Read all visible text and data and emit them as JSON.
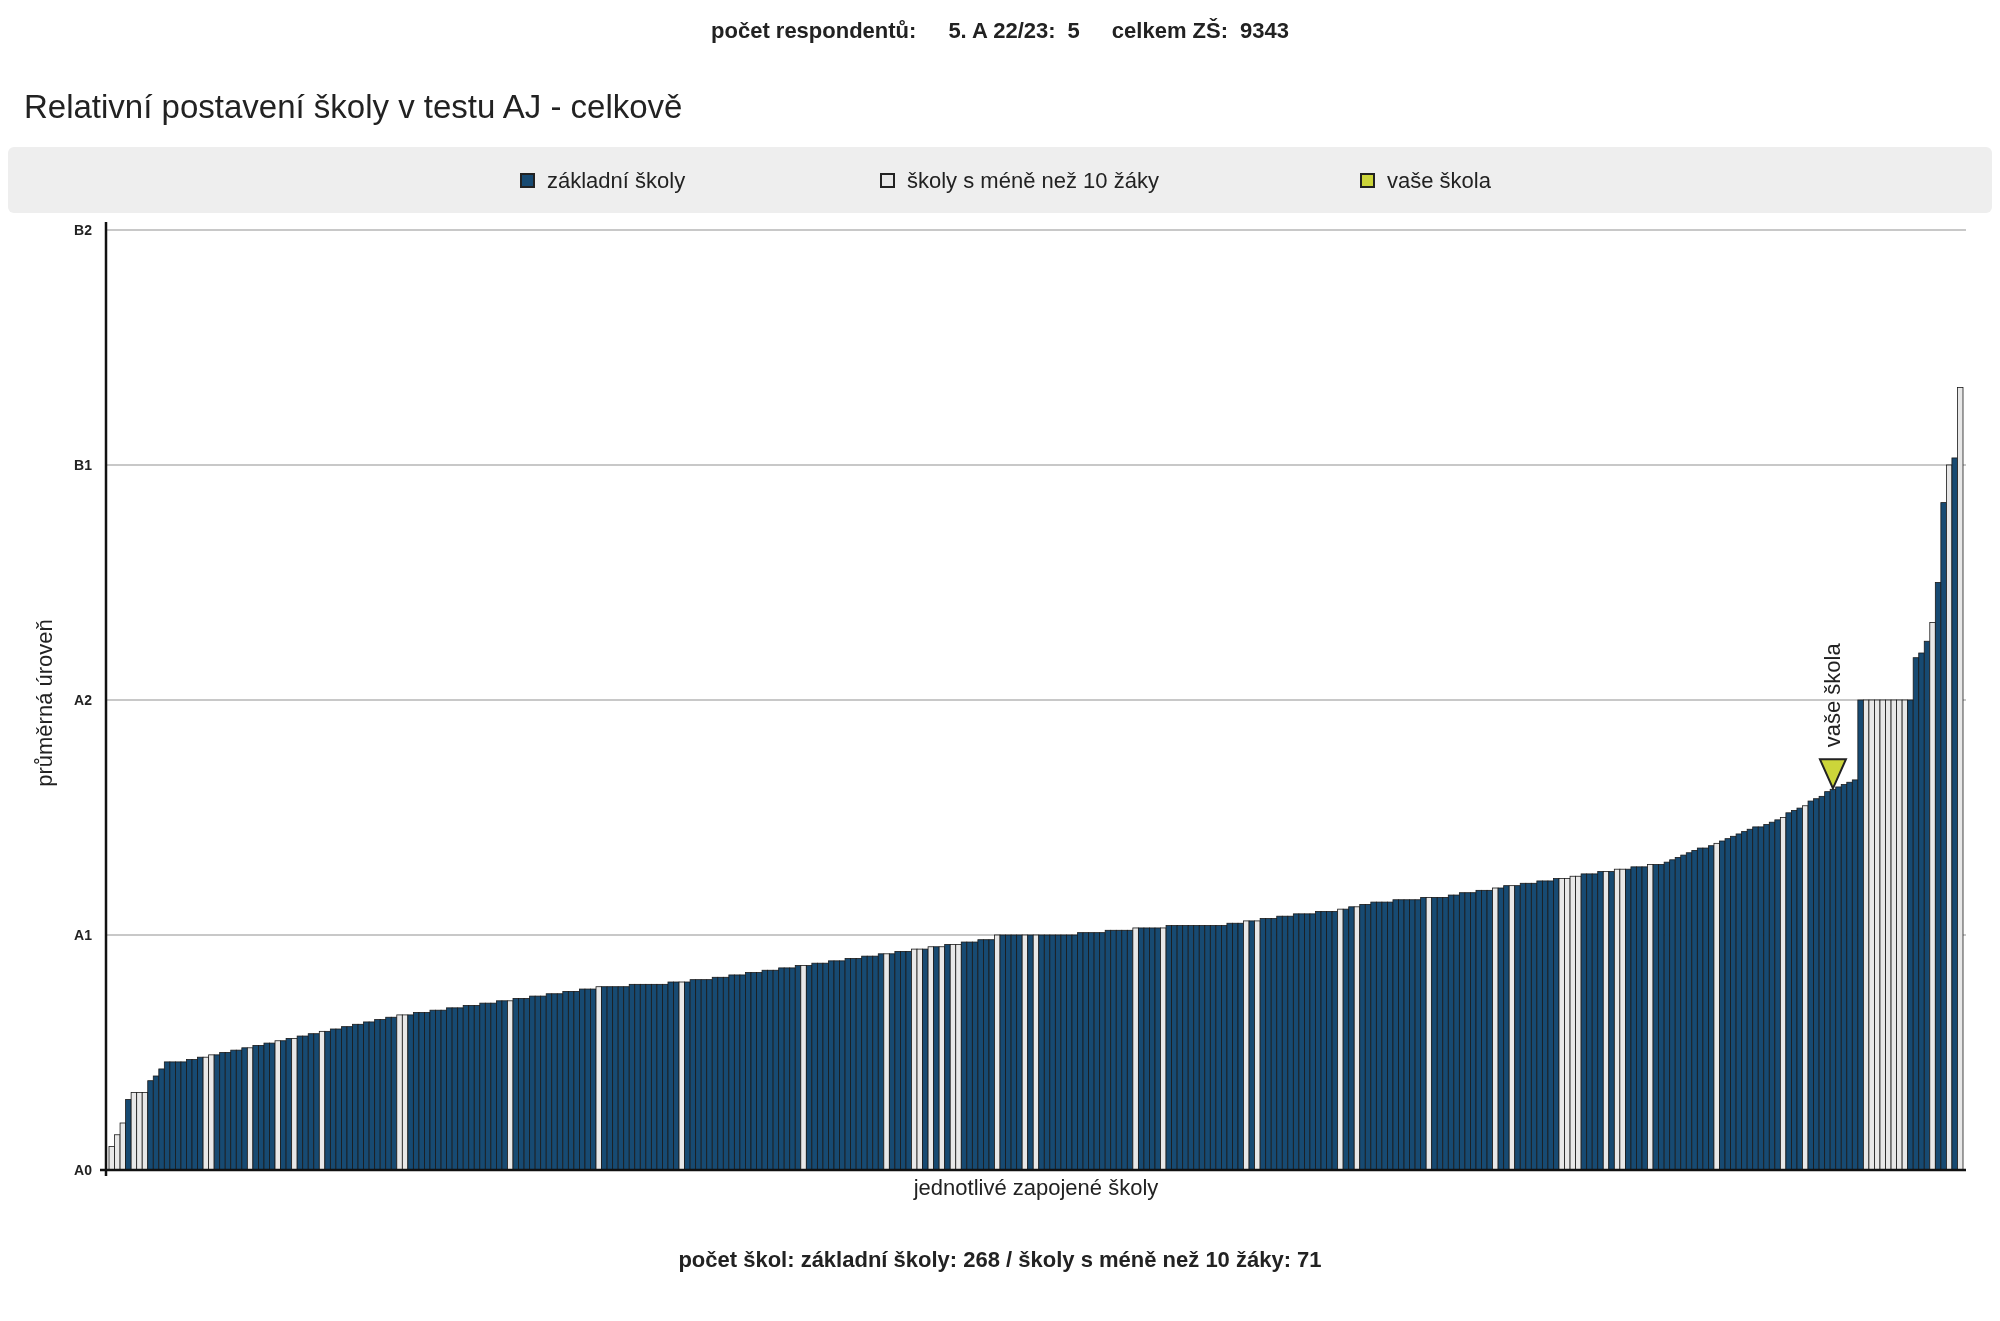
{
  "header": [
    {
      "label": "počet respondentů:"
    },
    {
      "label": "5. A 22/23:",
      "value": "5"
    },
    {
      "label": "celkem ZŠ:",
      "value": "9343"
    }
  ],
  "title": "Relativní postavení školy v testu AJ - celkově",
  "legend": [
    {
      "label": "základní školy",
      "color": "#174a72",
      "kind": "bar"
    },
    {
      "label": "školy s méně než 10 žáky",
      "color": "#e8e8e8",
      "kind": "bar"
    },
    {
      "label": "vaše škola",
      "color": "#ccd53a",
      "kind": "marker"
    }
  ],
  "chart": {
    "y_axis_title": "průměrná úroveň",
    "y_ticks": [
      "B2",
      "B1",
      "A2",
      "A1",
      "A0"
    ],
    "marker_label": "vaše škola",
    "x_axis_title": "jednotlivé zapojené školy"
  },
  "footer": "počet škol: základní školy: 268 / školy s méně než 10 žáky: 71"
}
